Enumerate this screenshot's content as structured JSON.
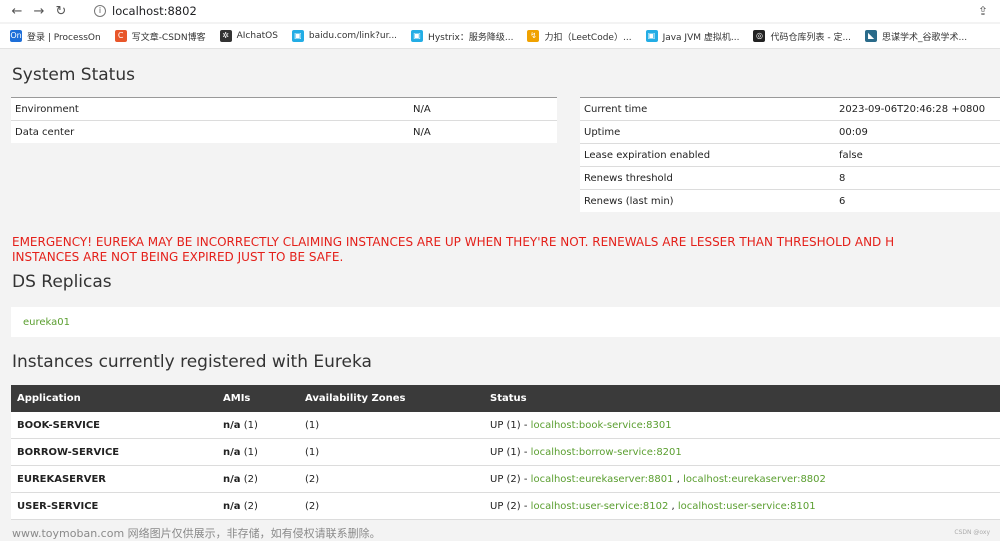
{
  "browser": {
    "url": "localhost:8802",
    "bookmarks": [
      {
        "label": "登录 | ProcessOn",
        "icon": "processon-icon",
        "color": "#1e6fd9",
        "glyph": "On"
      },
      {
        "label": "写文章-CSDN博客",
        "icon": "csdn-icon",
        "color": "#e8562a",
        "glyph": "C"
      },
      {
        "label": "AIchatOS",
        "icon": "openai-icon",
        "color": "#333333",
        "glyph": "✲"
      },
      {
        "label": "baidu.com/link?ur...",
        "icon": "bilibili-icon",
        "color": "#23ade5",
        "glyph": "▣"
      },
      {
        "label": "Hystrix：服务降级...",
        "icon": "bilibili-icon",
        "color": "#23ade5",
        "glyph": "▣"
      },
      {
        "label": "力扣（LeetCode）...",
        "icon": "leetcode-icon",
        "color": "#f0a200",
        "glyph": "↯"
      },
      {
        "label": "Java JVM 虚拟机...",
        "icon": "bilibili-icon",
        "color": "#23ade5",
        "glyph": "▣"
      },
      {
        "label": "代码仓库列表 - 定...",
        "icon": "coding-icon",
        "color": "#222222",
        "glyph": "◎"
      },
      {
        "label": "思谋学术_谷歌学术...",
        "icon": "scholar-icon",
        "color": "#2a6b8a",
        "glyph": "◣"
      }
    ]
  },
  "system_status": {
    "title": "System Status",
    "left": [
      {
        "key": "Environment",
        "value": "N/A"
      },
      {
        "key": "Data center",
        "value": "N/A"
      }
    ],
    "right": [
      {
        "key": "Current time",
        "value": "2023-09-06T20:46:28 +0800"
      },
      {
        "key": "Uptime",
        "value": "00:09"
      },
      {
        "key": "Lease expiration enabled",
        "value": "false"
      },
      {
        "key": "Renews threshold",
        "value": "8"
      },
      {
        "key": "Renews (last min)",
        "value": "6"
      }
    ]
  },
  "emergency": {
    "line1": "EMERGENCY! EUREKA MAY BE INCORRECTLY CLAIMING INSTANCES ARE UP WHEN THEY'RE NOT. RENEWALS ARE LESSER THAN THRESHOLD AND H",
    "line2": "INSTANCES ARE NOT BEING EXPIRED JUST TO BE SAFE.",
    "color": "#e4201a"
  },
  "ds_replicas": {
    "title": "DS Replicas",
    "items": [
      "eureka01"
    ]
  },
  "instances": {
    "title": "Instances currently registered with Eureka",
    "columns": [
      "Application",
      "AMIs",
      "Availability Zones",
      "Status"
    ],
    "rows": [
      {
        "application": "BOOK-SERVICE",
        "ami_bold": "n/a",
        "ami_count": " (1)",
        "zones": "(1)",
        "status_prefix": "UP (1) - ",
        "links": [
          "localhost:book-service:8301"
        ]
      },
      {
        "application": "BORROW-SERVICE",
        "ami_bold": "n/a",
        "ami_count": " (1)",
        "zones": "(1)",
        "status_prefix": "UP (1) - ",
        "links": [
          "localhost:borrow-service:8201"
        ]
      },
      {
        "application": "EUREKASERVER",
        "ami_bold": "n/a",
        "ami_count": " (2)",
        "zones": "(2)",
        "status_prefix": "UP (2) - ",
        "links": [
          "localhost:eurekaserver:8801",
          "localhost:eurekaserver:8802"
        ]
      },
      {
        "application": "USER-SERVICE",
        "ami_bold": "n/a",
        "ami_count": " (2)",
        "zones": "(2)",
        "status_prefix": "UP (2) - ",
        "links": [
          "localhost:user-service:8102",
          "localhost:user-service:8101"
        ]
      }
    ],
    "link_color": "#5a9e2f"
  },
  "watermark": "www.toymoban.com 网络图片仅供展示，非存储，如有侵权请联系删除。",
  "corner_mark": "CSDN @oxy"
}
